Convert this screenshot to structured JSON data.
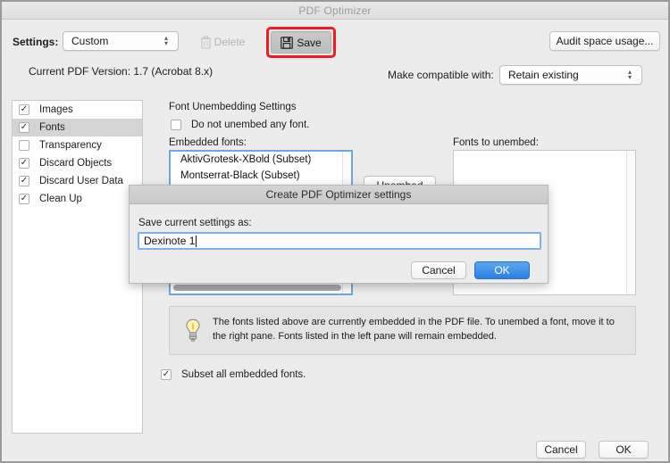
{
  "window": {
    "title": "PDF Optimizer"
  },
  "toolbar": {
    "settings_label": "Settings:",
    "settings_value": "Custom",
    "delete_label": "Delete",
    "delete_icon": "trash-icon",
    "save_label": "Save",
    "save_icon": "floppy-disk-icon",
    "audit_label": "Audit space usage...",
    "highlight_color": "#ee1c24"
  },
  "version": {
    "text": "Current PDF Version: 1.7 (Acrobat 8.x)"
  },
  "compatibility": {
    "label": "Make compatible with:",
    "value": "Retain existing"
  },
  "sidebar": {
    "items": [
      {
        "label": "Images",
        "checked": true,
        "selected": false
      },
      {
        "label": "Fonts",
        "checked": true,
        "selected": true
      },
      {
        "label": "Transparency",
        "checked": false,
        "selected": false
      },
      {
        "label": "Discard Objects",
        "checked": true,
        "selected": false
      },
      {
        "label": "Discard User Data",
        "checked": true,
        "selected": false
      },
      {
        "label": "Clean Up",
        "checked": true,
        "selected": false
      }
    ]
  },
  "main": {
    "panel_title": "Font Unembedding Settings",
    "no_unembed_label": "Do not unembed any font.",
    "no_unembed_checked": false,
    "embedded_label": "Embedded fonts:",
    "unembed_label": "Fonts to unembed:",
    "embedded_fonts": [
      "AktivGrotesk-XBold (Subset)",
      "Montserrat-Black (Subset)"
    ],
    "fonts_to_unembed": [],
    "unembed_button_label": "Unembed",
    "tip_icon": "lightbulb-icon",
    "tip_text": "The fonts listed above are currently embedded in the PDF file. To unembed a font, move it to the right pane. Fonts listed in the left pane will remain embedded.",
    "subset_label": "Subset all embedded fonts.",
    "subset_checked": true
  },
  "footer": {
    "cancel_label": "Cancel",
    "ok_label": "OK"
  },
  "modal": {
    "title": "Create PDF Optimizer settings",
    "field_label": "Save current settings as:",
    "input_value": "Dexinote 1",
    "input_placeholder": "",
    "cancel_label": "Cancel",
    "ok_label": "OK",
    "ok_color": "#2b7fe0"
  },
  "glyphs": {
    "check": "✓",
    "stepper_up": "▴",
    "stepper_down": "▾"
  }
}
